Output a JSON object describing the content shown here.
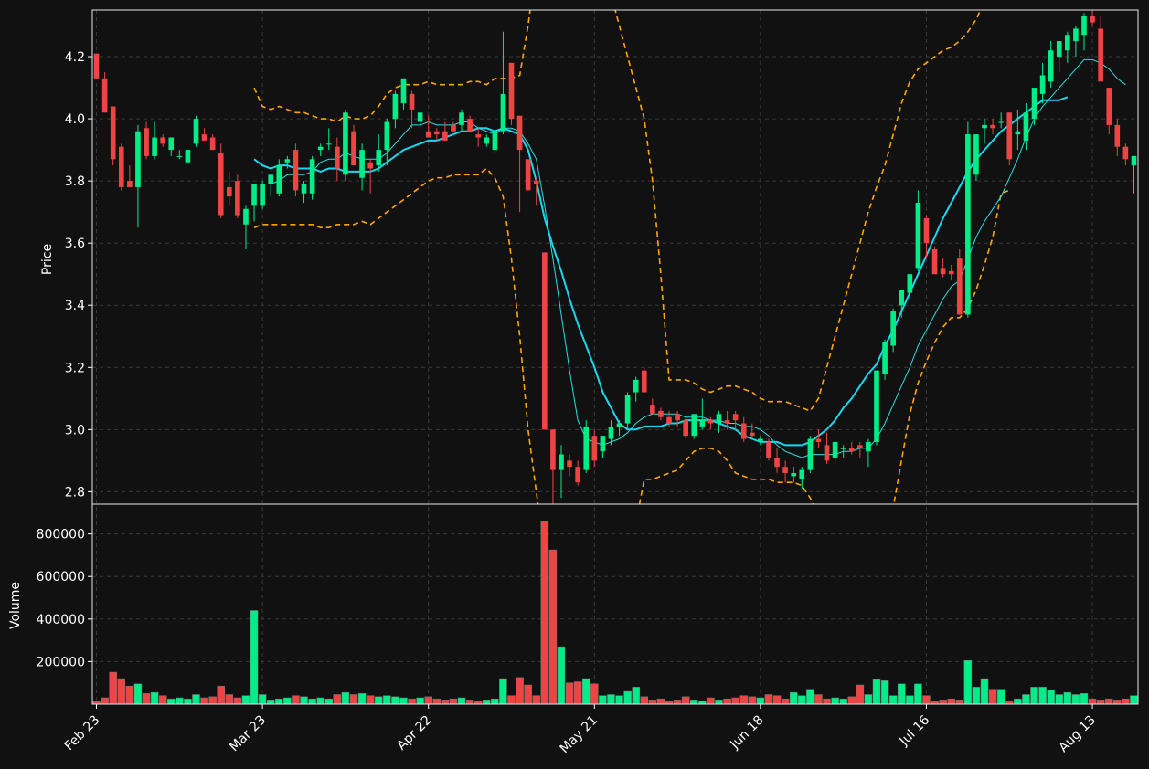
{
  "colors": {
    "background": "#111111",
    "axes_edge": "#e6e6e6",
    "grid": "#3a3a3a",
    "up": "#00ee88",
    "down": "#ee4444",
    "ma_fast": "#27e0e0",
    "ma_slow": "#18d8f0",
    "bands": "#ffa500",
    "text": "#ffffff"
  },
  "chart_data": {
    "type": "candlestick",
    "ylabel_price": "Price",
    "ylabel_volume": "Volume",
    "price_ylim": [
      2.76,
      4.35
    ],
    "volume_ylim": [
      0,
      940000
    ],
    "price_ticks": [
      2.8,
      3.0,
      3.2,
      3.4,
      3.6,
      3.8,
      4.0,
      4.2
    ],
    "volume_ticks": [
      200000,
      400000,
      600000,
      800000
    ],
    "x_ticks": [
      {
        "label": "Feb 23",
        "index": 0
      },
      {
        "label": "Mar 23",
        "index": 20
      },
      {
        "label": "Apr 22",
        "index": 40
      },
      {
        "label": "May 21",
        "index": 60
      },
      {
        "label": "Jun 18",
        "index": 80
      },
      {
        "label": "Jul 16",
        "index": 100
      },
      {
        "label": "Aug 13",
        "index": 120
      }
    ],
    "candles": [
      [
        4.21,
        4.21,
        4.13,
        4.13,
        12000
      ],
      [
        4.13,
        4.15,
        4.02,
        4.02,
        30000
      ],
      [
        4.04,
        4.04,
        3.85,
        3.87,
        150000
      ],
      [
        3.91,
        3.92,
        3.77,
        3.78,
        120000
      ],
      [
        3.8,
        3.85,
        3.78,
        3.78,
        85000
      ],
      [
        3.78,
        3.98,
        3.65,
        3.96,
        95000
      ],
      [
        3.97,
        3.99,
        3.87,
        3.88,
        50000
      ],
      [
        3.88,
        3.99,
        3.87,
        3.94,
        55000
      ],
      [
        3.94,
        3.95,
        3.91,
        3.92,
        40000
      ],
      [
        3.9,
        3.94,
        3.88,
        3.94,
        25000
      ],
      [
        3.88,
        3.9,
        3.87,
        3.88,
        30000
      ],
      [
        3.86,
        3.9,
        3.86,
        3.9,
        25000
      ],
      [
        3.92,
        4.01,
        3.91,
        4.0,
        45000
      ],
      [
        3.95,
        3.97,
        3.93,
        3.93,
        30000
      ],
      [
        3.94,
        3.95,
        3.9,
        3.9,
        35000
      ],
      [
        3.89,
        3.92,
        3.68,
        3.69,
        85000
      ],
      [
        3.78,
        3.83,
        3.72,
        3.75,
        45000
      ],
      [
        3.8,
        3.82,
        3.68,
        3.69,
        30000
      ],
      [
        3.66,
        3.72,
        3.58,
        3.71,
        40000
      ],
      [
        3.72,
        3.79,
        3.67,
        3.79,
        440000
      ],
      [
        3.72,
        3.8,
        3.71,
        3.79,
        45000
      ],
      [
        3.79,
        3.82,
        3.75,
        3.82,
        20000
      ],
      [
        3.76,
        3.87,
        3.75,
        3.85,
        25000
      ],
      [
        3.86,
        3.88,
        3.84,
        3.87,
        30000
      ],
      [
        3.9,
        3.92,
        3.75,
        3.77,
        40000
      ],
      [
        3.76,
        3.8,
        3.73,
        3.79,
        35000
      ],
      [
        3.76,
        3.88,
        3.74,
        3.87,
        25000
      ],
      [
        3.9,
        3.92,
        3.88,
        3.91,
        30000
      ],
      [
        3.92,
        3.97,
        3.9,
        3.92,
        25000
      ],
      [
        3.91,
        3.94,
        3.8,
        3.84,
        45000
      ],
      [
        3.82,
        4.03,
        3.8,
        4.02,
        55000
      ],
      [
        3.96,
        3.98,
        3.85,
        3.85,
        45000
      ],
      [
        3.81,
        3.92,
        3.77,
        3.9,
        50000
      ],
      [
        3.86,
        3.87,
        3.76,
        3.84,
        40000
      ],
      [
        3.85,
        3.95,
        3.83,
        3.9,
        35000
      ],
      [
        3.9,
        4.0,
        3.85,
        3.99,
        40000
      ],
      [
        4.0,
        4.09,
        3.97,
        4.08,
        35000
      ],
      [
        4.05,
        4.13,
        4.03,
        4.13,
        30000
      ],
      [
        4.08,
        4.09,
        3.97,
        4.03,
        25000
      ],
      [
        3.99,
        4.02,
        3.97,
        4.02,
        30000
      ],
      [
        3.96,
        4.01,
        3.94,
        3.94,
        35000
      ],
      [
        3.96,
        3.97,
        3.93,
        3.95,
        25000
      ],
      [
        3.96,
        3.99,
        3.93,
        3.93,
        20000
      ],
      [
        3.98,
        3.99,
        3.96,
        3.96,
        25000
      ],
      [
        3.98,
        4.03,
        3.96,
        4.02,
        30000
      ],
      [
        4.0,
        4.01,
        3.96,
        3.96,
        20000
      ],
      [
        3.95,
        3.97,
        3.91,
        3.94,
        15000
      ],
      [
        3.92,
        3.95,
        3.91,
        3.94,
        20000
      ],
      [
        3.9,
        3.96,
        3.89,
        3.96,
        25000
      ],
      [
        3.96,
        4.28,
        3.95,
        4.08,
        120000
      ],
      [
        4.18,
        4.18,
        3.98,
        4.0,
        40000
      ],
      [
        4.01,
        4.01,
        3.7,
        3.9,
        125000
      ],
      [
        3.87,
        3.87,
        3.77,
        3.77,
        90000
      ],
      [
        3.8,
        3.81,
        3.72,
        3.79,
        40000
      ],
      [
        3.57,
        3.57,
        3.0,
        3.0,
        860000
      ],
      [
        3.0,
        3.0,
        2.72,
        2.87,
        725000
      ],
      [
        2.87,
        2.95,
        2.78,
        2.92,
        270000
      ],
      [
        2.9,
        2.92,
        2.85,
        2.88,
        100000
      ],
      [
        2.88,
        2.9,
        2.82,
        2.83,
        105000
      ],
      [
        2.87,
        3.03,
        2.86,
        3.01,
        120000
      ],
      [
        2.98,
        3.0,
        2.88,
        2.9,
        95000
      ],
      [
        2.93,
        2.98,
        2.91,
        2.98,
        40000
      ],
      [
        2.97,
        3.03,
        2.95,
        3.01,
        45000
      ],
      [
        3.01,
        3.03,
        2.98,
        3.02,
        40000
      ],
      [
        3.02,
        3.12,
        3.0,
        3.11,
        60000
      ],
      [
        3.12,
        3.17,
        3.09,
        3.16,
        80000
      ],
      [
        3.19,
        3.2,
        3.12,
        3.12,
        35000
      ],
      [
        3.08,
        3.1,
        3.05,
        3.05,
        20000
      ],
      [
        3.06,
        3.07,
        3.03,
        3.04,
        25000
      ],
      [
        3.04,
        3.06,
        3.01,
        3.02,
        15000
      ],
      [
        3.05,
        3.06,
        3.01,
        3.03,
        20000
      ],
      [
        3.03,
        3.04,
        2.97,
        2.98,
        35000
      ],
      [
        2.98,
        3.05,
        2.97,
        3.05,
        20000
      ],
      [
        3.01,
        3.1,
        3.0,
        3.03,
        15000
      ],
      [
        3.03,
        3.04,
        3.0,
        3.02,
        30000
      ],
      [
        3.02,
        3.06,
        2.99,
        3.05,
        20000
      ],
      [
        3.03,
        3.06,
        3.0,
        3.02,
        25000
      ],
      [
        3.05,
        3.06,
        3.0,
        3.03,
        30000
      ],
      [
        3.02,
        3.04,
        2.96,
        2.97,
        40000
      ],
      [
        2.99,
        3.02,
        2.97,
        2.98,
        35000
      ],
      [
        2.96,
        2.98,
        2.95,
        2.97,
        30000
      ],
      [
        2.96,
        2.97,
        2.9,
        2.91,
        45000
      ],
      [
        2.91,
        2.94,
        2.86,
        2.88,
        40000
      ],
      [
        2.88,
        2.9,
        2.83,
        2.86,
        25000
      ],
      [
        2.85,
        2.88,
        2.83,
        2.86,
        55000
      ],
      [
        2.84,
        2.88,
        2.81,
        2.87,
        40000
      ],
      [
        2.87,
        2.98,
        2.86,
        2.97,
        70000
      ],
      [
        2.97,
        3.0,
        2.94,
        2.96,
        45000
      ],
      [
        2.95,
        2.99,
        2.89,
        2.9,
        25000
      ],
      [
        2.91,
        2.96,
        2.89,
        2.96,
        30000
      ],
      [
        2.94,
        2.95,
        2.91,
        2.94,
        25000
      ],
      [
        2.94,
        2.96,
        2.92,
        2.93,
        35000
      ],
      [
        2.95,
        2.96,
        2.91,
        2.94,
        90000
      ],
      [
        2.93,
        2.97,
        2.88,
        2.96,
        45000
      ],
      [
        2.96,
        3.19,
        2.95,
        3.19,
        115000
      ],
      [
        3.18,
        3.29,
        3.16,
        3.28,
        110000
      ],
      [
        3.27,
        3.39,
        3.25,
        3.38,
        40000
      ],
      [
        3.4,
        3.45,
        3.36,
        3.45,
        95000
      ],
      [
        3.44,
        3.5,
        3.42,
        3.5,
        40000
      ],
      [
        3.52,
        3.77,
        3.51,
        3.73,
        95000
      ],
      [
        3.68,
        3.69,
        3.55,
        3.6,
        40000
      ],
      [
        3.58,
        3.59,
        3.5,
        3.5,
        15000
      ],
      [
        3.52,
        3.55,
        3.49,
        3.5,
        20000
      ],
      [
        3.51,
        3.53,
        3.48,
        3.5,
        25000
      ],
      [
        3.55,
        3.58,
        3.37,
        3.37,
        20000
      ],
      [
        3.37,
        3.99,
        3.36,
        3.95,
        205000
      ],
      [
        3.82,
        3.95,
        3.8,
        3.95,
        80000
      ],
      [
        3.97,
        4.0,
        3.92,
        3.98,
        120000
      ],
      [
        3.98,
        4.0,
        3.95,
        3.97,
        70000
      ],
      [
        3.99,
        4.02,
        3.97,
        3.99,
        70000
      ],
      [
        4.02,
        4.02,
        3.85,
        3.87,
        15000
      ],
      [
        3.95,
        4.03,
        3.9,
        3.96,
        25000
      ],
      [
        3.93,
        4.05,
        3.9,
        4.02,
        45000
      ],
      [
        4.0,
        4.1,
        3.98,
        4.1,
        80000
      ],
      [
        4.08,
        4.18,
        4.05,
        4.14,
        80000
      ],
      [
        4.12,
        4.25,
        4.1,
        4.22,
        65000
      ],
      [
        4.2,
        4.25,
        4.15,
        4.25,
        45000
      ],
      [
        4.22,
        4.28,
        4.18,
        4.27,
        55000
      ],
      [
        4.25,
        4.3,
        4.2,
        4.29,
        45000
      ],
      [
        4.27,
        4.34,
        4.22,
        4.33,
        50000
      ],
      [
        4.33,
        4.35,
        4.3,
        4.31,
        25000
      ],
      [
        4.29,
        4.33,
        4.12,
        4.12,
        20000
      ],
      [
        4.1,
        4.1,
        3.95,
        3.98,
        25000
      ],
      [
        3.98,
        4.0,
        3.88,
        3.91,
        20000
      ],
      [
        3.91,
        3.92,
        3.85,
        3.87,
        25000
      ],
      [
        3.85,
        3.88,
        3.76,
        3.88,
        40000
      ]
    ],
    "ma_fast": [
      null,
      null,
      null,
      null,
      null,
      null,
      null,
      null,
      null,
      null,
      null,
      null,
      null,
      null,
      null,
      null,
      null,
      null,
      null,
      null,
      3.79,
      3.79,
      3.8,
      3.82,
      3.82,
      3.82,
      3.83,
      3.86,
      3.87,
      3.87,
      3.89,
      3.88,
      3.87,
      3.87,
      3.87,
      3.89,
      3.92,
      3.95,
      3.98,
      3.98,
      3.99,
      3.98,
      3.98,
      3.98,
      3.99,
      3.99,
      3.97,
      3.96,
      3.95,
      3.97,
      3.97,
      3.96,
      3.92,
      3.87,
      3.72,
      3.55,
      3.37,
      3.19,
      3.03,
      2.97,
      2.96,
      2.95,
      2.96,
      2.97,
      2.99,
      3.02,
      3.04,
      3.05,
      3.05,
      3.05,
      3.05,
      3.04,
      3.04,
      3.04,
      3.03,
      3.03,
      3.02,
      3.02,
      3.01,
      3.01,
      3.0,
      2.98,
      2.95,
      2.93,
      2.92,
      2.91,
      2.92,
      2.92,
      2.92,
      2.92,
      2.93,
      2.93,
      2.94,
      2.94,
      2.97,
      3.02,
      3.08,
      3.14,
      3.2,
      3.27,
      3.32,
      3.37,
      3.42,
      3.46,
      3.48,
      3.55,
      3.62,
      3.67,
      3.71,
      3.75,
      3.81,
      3.87,
      3.94,
      4.0,
      4.04,
      4.07,
      4.1,
      4.13,
      4.16,
      4.19,
      4.19,
      4.18,
      4.16,
      4.13,
      4.11
    ],
    "ma_slow": [
      null,
      null,
      null,
      null,
      null,
      null,
      null,
      null,
      null,
      null,
      null,
      null,
      null,
      null,
      null,
      null,
      null,
      null,
      null,
      3.87,
      3.85,
      3.84,
      3.85,
      3.85,
      3.84,
      3.84,
      3.84,
      3.83,
      3.84,
      3.84,
      3.83,
      3.83,
      3.83,
      3.83,
      3.84,
      3.86,
      3.88,
      3.9,
      3.91,
      3.92,
      3.93,
      3.93,
      3.94,
      3.95,
      3.96,
      3.96,
      3.97,
      3.97,
      3.96,
      3.97,
      3.96,
      3.95,
      3.9,
      3.8,
      3.68,
      3.59,
      3.51,
      3.42,
      3.34,
      3.27,
      3.2,
      3.12,
      3.07,
      3.02,
      3.0,
      3.0,
      3.01,
      3.01,
      3.01,
      3.02,
      3.02,
      3.03,
      3.03,
      3.03,
      3.03,
      3.02,
      3.01,
      3.0,
      2.98,
      2.97,
      2.96,
      2.96,
      2.96,
      2.95,
      2.95,
      2.95,
      2.96,
      2.98,
      3.0,
      3.03,
      3.07,
      3.1,
      3.14,
      3.18,
      3.21,
      3.27,
      3.32,
      3.38,
      3.44,
      3.5,
      3.56,
      3.62,
      3.68,
      3.73,
      3.78,
      3.83,
      3.87,
      3.9,
      3.93,
      3.96,
      3.98,
      4.0,
      4.02,
      4.04,
      4.06,
      4.06,
      4.06,
      4.07
    ],
    "band_upper": [
      null,
      null,
      null,
      null,
      null,
      null,
      null,
      null,
      null,
      null,
      null,
      null,
      null,
      null,
      null,
      null,
      null,
      null,
      null,
      4.1,
      4.04,
      4.03,
      4.04,
      4.03,
      4.02,
      4.02,
      4.01,
      4.0,
      4.0,
      3.99,
      4.01,
      4.0,
      4.0,
      4.01,
      4.04,
      4.08,
      4.1,
      4.11,
      4.11,
      4.11,
      4.12,
      4.11,
      4.11,
      4.11,
      4.11,
      4.12,
      4.12,
      4.11,
      4.13,
      4.13,
      4.13,
      4.14,
      4.3,
      4.5,
      4.6,
      4.65,
      4.7,
      4.65,
      4.6,
      4.55,
      4.5,
      4.45,
      4.4,
      4.3,
      4.2,
      4.1,
      4.0,
      3.8,
      3.5,
      3.16,
      3.16,
      3.16,
      3.15,
      3.13,
      3.12,
      3.13,
      3.14,
      3.14,
      3.13,
      3.12,
      3.1,
      3.09,
      3.09,
      3.09,
      3.08,
      3.07,
      3.06,
      3.1,
      3.2,
      3.3,
      3.4,
      3.5,
      3.6,
      3.7,
      3.78,
      3.85,
      3.95,
      4.05,
      4.12,
      4.16,
      4.18,
      4.2,
      4.22,
      4.23,
      4.25,
      4.28,
      4.32,
      4.38,
      4.45,
      4.55,
      4.7,
      4.8,
      4.9
    ],
    "band_lower": [
      null,
      null,
      null,
      null,
      null,
      null,
      null,
      null,
      null,
      null,
      null,
      null,
      null,
      null,
      null,
      null,
      null,
      null,
      null,
      3.65,
      3.66,
      3.66,
      3.66,
      3.66,
      3.66,
      3.66,
      3.66,
      3.65,
      3.65,
      3.66,
      3.66,
      3.66,
      3.67,
      3.66,
      3.68,
      3.7,
      3.72,
      3.74,
      3.76,
      3.78,
      3.8,
      3.81,
      3.81,
      3.82,
      3.82,
      3.82,
      3.82,
      3.84,
      3.81,
      3.75,
      3.55,
      3.3,
      3.0,
      2.8,
      2.6,
      2.4,
      2.2,
      2.1,
      2.0,
      2.0,
      2.05,
      2.1,
      2.2,
      2.35,
      2.5,
      2.7,
      2.84,
      2.84,
      2.85,
      2.86,
      2.87,
      2.9,
      2.93,
      2.94,
      2.94,
      2.93,
      2.9,
      2.86,
      2.85,
      2.84,
      2.84,
      2.84,
      2.83,
      2.83,
      2.83,
      2.82,
      2.78,
      2.72,
      2.65,
      2.58,
      2.5,
      2.43,
      2.38,
      2.4,
      2.5,
      2.6,
      2.75,
      2.9,
      3.05,
      3.15,
      3.22,
      3.28,
      3.33,
      3.36,
      3.36,
      3.39,
      3.45,
      3.53,
      3.62,
      3.76,
      3.77
    ]
  }
}
